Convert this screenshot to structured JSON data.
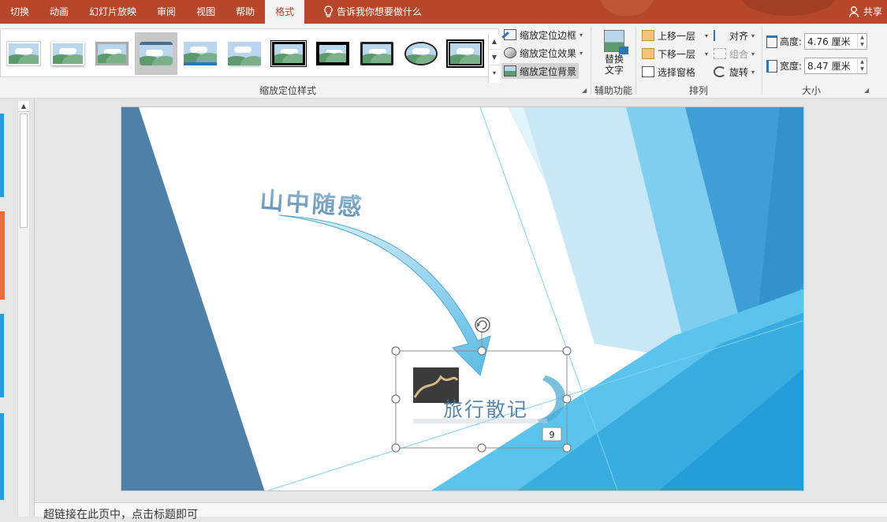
{
  "ribbon_tabs": [
    {
      "label": "切换"
    },
    {
      "label": "动画"
    },
    {
      "label": "幻灯片放映"
    },
    {
      "label": "审阅"
    },
    {
      "label": "视图"
    },
    {
      "label": "帮助"
    },
    {
      "label": "格式",
      "active": true
    }
  ],
  "tell_me": "告诉我你想要做什么",
  "share": "共享",
  "zoom_styles": {
    "group_label": "缩放定位样式",
    "selected_index": 3,
    "border_label": "缩放定位边框",
    "effect_label": "缩放定位效果",
    "background_label": "缩放定位背景"
  },
  "accessibility": {
    "alt_text_line1": "替换",
    "alt_text_line2": "文字",
    "group_label": "辅助功能"
  },
  "arrange": {
    "bring_forward": "上移一层",
    "send_backward": "下移一层",
    "selection_pane": "选择窗格",
    "align": "对齐",
    "group": "组合",
    "rotate": "旋转",
    "group_label": "排列"
  },
  "size": {
    "height_label": "高度:",
    "height_value": "4.76 厘米",
    "width_label": "宽度:",
    "width_value": "8.47 厘米",
    "group_label": "大小"
  },
  "slide": {
    "title": "山中随感",
    "zoom_caption": "旅行散记",
    "zoom_badge": "9"
  },
  "notes_text": "超链接在此页中，点击标题即可",
  "colors": {
    "accent": "#b7472a",
    "slide_blue_dark": "#4f81a8",
    "slide_blue_light": "#5bc3ec",
    "arrow_blue": "#6cc4e6"
  }
}
